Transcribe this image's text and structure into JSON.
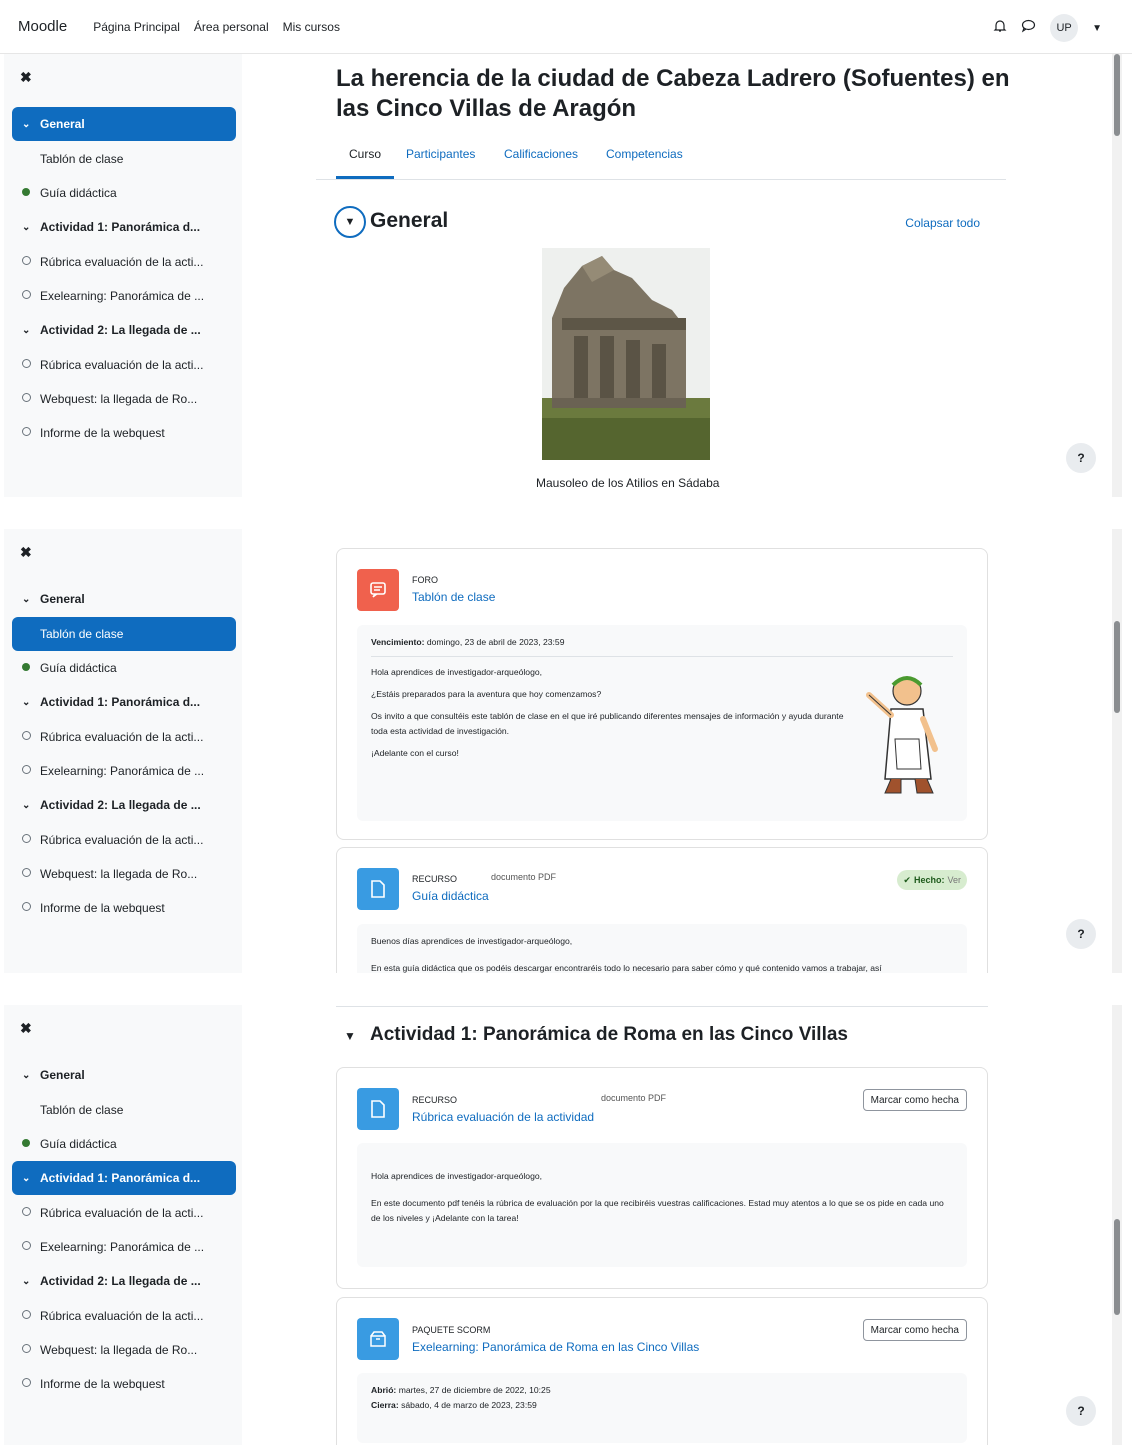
{
  "topbar": {
    "brand": "Moodle",
    "links": [
      "Página Principal",
      "Área personal",
      "Mis cursos"
    ],
    "user_initials": "UP"
  },
  "icons": {
    "bell": "bell-icon",
    "chat": "chat-icon",
    "close": "close-icon",
    "chevron": "chevron-down-icon",
    "help": "help-icon"
  },
  "course_index": [
    {
      "label": "General",
      "type": "section"
    },
    {
      "label": "Tablón de clase",
      "type": "activity"
    },
    {
      "label": "Guía didáctica",
      "type": "activity-done"
    },
    {
      "label": "Actividad 1: Panorámica d...",
      "type": "section"
    },
    {
      "label": "Rúbrica evaluación de la acti...",
      "type": "activity-open"
    },
    {
      "label": "Exelearning: Panorámica de ...",
      "type": "activity-open"
    },
    {
      "label": "Actividad 2: La llegada de ...",
      "type": "section"
    },
    {
      "label": "Rúbrica evaluación de la acti...",
      "type": "activity-open"
    },
    {
      "label": "Webquest: la llegada de Ro...",
      "type": "activity-open"
    },
    {
      "label": "Informe de la webquest",
      "type": "activity-open"
    }
  ],
  "course": {
    "title": "La herencia de la ciudad de Cabeza Ladrero (Sofuentes) en las Cinco Villas de Aragón",
    "tabs": [
      "Curso",
      "Participantes",
      "Calificaciones",
      "Competencias"
    ],
    "section_general": "General",
    "collapse_all": "Colapsar todo",
    "image_caption": "Mausoleo de los Atilios en Sádaba"
  },
  "forum": {
    "module": "FORO",
    "name": "Tablón de clase",
    "due_label": "Vencimiento:",
    "due_value": "domingo, 23 de abril de 2023, 23:59",
    "p1": "Hola aprendices de investigador-arqueólogo,",
    "p2": "¿Estáis preparados para la aventura que hoy comenzamos?",
    "p3": "Os invito a que consultéis este tablón de clase en el que iré publicando diferentes mensajes de información y ayuda durante toda esta actividad de investigación.",
    "p4": "¡Adelante con el curso!"
  },
  "guide": {
    "module": "RECURSO",
    "type": "documento PDF",
    "name": "Guía didáctica",
    "done_label": "Hecho:",
    "done_value": "Ver",
    "p1": "Buenos días aprendices de investigador-arqueólogo,",
    "p2": "En esta guía didáctica que os podéis descargar encontraréis todo lo necesario para saber cómo y qué contenido vamos a trabajar, así"
  },
  "activity1": {
    "title": "Actividad 1: Panorámica de Roma en las Cinco Villas",
    "rubric": {
      "module": "RECURSO",
      "type": "documento PDF",
      "name": "Rúbrica evaluación de la actividad",
      "button": "Marcar como hecha",
      "p1": "Hola aprendices de investigador-arqueólogo,",
      "p2": "En este documento pdf tenéis la rúbrica de evaluación por la que recibiréis vuestras calificaciones. Estad muy atentos a lo que se os pide en cada uno de los niveles y ¡Adelante con la tarea!"
    },
    "scorm": {
      "module": "PAQUETE SCORM",
      "name": "Exelearning: Panorámica de Roma en las Cinco Villas",
      "button": "Marcar como hecha",
      "open_label": "Abrió:",
      "open_value": "martes, 27 de diciembre de 2022, 10:25",
      "close_label": "Cierra:",
      "close_value": "sábado, 4 de marzo de 2023, 23:59"
    }
  },
  "colors": {
    "primary": "#0f6cbf",
    "forum": "#f0614d",
    "resource": "#399be2",
    "done": "#357a32"
  }
}
